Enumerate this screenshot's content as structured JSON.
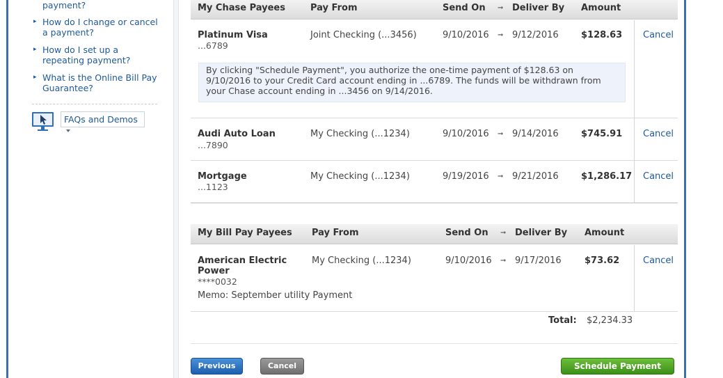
{
  "sidebar": {
    "links": [
      {
        "label": "payment?"
      },
      {
        "label": "How do I change or cancel a payment?"
      },
      {
        "label": "How do I set up a repeating payment?"
      },
      {
        "label": "What is the Online Bill Pay Guarantee?"
      }
    ],
    "faq_dropdown_label": "FAQs and Demos"
  },
  "chase_table": {
    "headers": {
      "payee": "My Chase Payees",
      "pay_from": "Pay From",
      "send_on": "Send On",
      "deliver_by": "Deliver By",
      "amount": "Amount"
    },
    "rows": [
      {
        "payee": "Platinum Visa",
        "account": "...6789",
        "pay_from": "Joint Checking (...3456)",
        "send_on": "9/10/2016",
        "deliver_by": "9/12/2016",
        "amount": "$128.63",
        "cancel": "Cancel"
      },
      {
        "payee": "Audi Auto Loan",
        "account": "...7890",
        "pay_from": "My Checking (...1234)",
        "send_on": "9/10/2016",
        "deliver_by": "9/14/2016",
        "amount": "$745.91",
        "cancel": "Cancel"
      },
      {
        "payee": "Mortgage",
        "account": "...1123",
        "pay_from": "My Checking (...1234)",
        "send_on": "9/19/2016",
        "deliver_by": "9/21/2016",
        "amount": "$1,286.17",
        "cancel": "Cancel"
      }
    ],
    "authorization_text": "By clicking \"Schedule Payment\", you authorize the one-time payment of $128.63 on 9/10/2016 to your Credit Card account ending in ...6789. The funds will be withdrawn from your Chase account ending in ...3456 on 9/14/2016."
  },
  "billpay_table": {
    "headers": {
      "payee": "My Bill Pay Payees",
      "pay_from": "Pay From",
      "send_on": "Send On",
      "deliver_by": "Deliver By",
      "amount": "Amount"
    },
    "rows": [
      {
        "payee": "American Electric Power",
        "account": "****0032",
        "memo": "Memo: September utility Payment",
        "pay_from": "My Checking (...1234)",
        "send_on": "9/10/2016",
        "deliver_by": "9/17/2016",
        "amount": "$73.62",
        "cancel": "Cancel"
      }
    ]
  },
  "total": {
    "label": "Total:",
    "value": "$2,234.33"
  },
  "buttons": {
    "previous": "Previous",
    "cancel": "Cancel",
    "schedule": "Schedule Payment"
  },
  "colors": {
    "link": "#1e5a99",
    "frame": "#3a6fb8",
    "primary_button": "#1c5fae",
    "schedule_button": "#3c8f18"
  }
}
